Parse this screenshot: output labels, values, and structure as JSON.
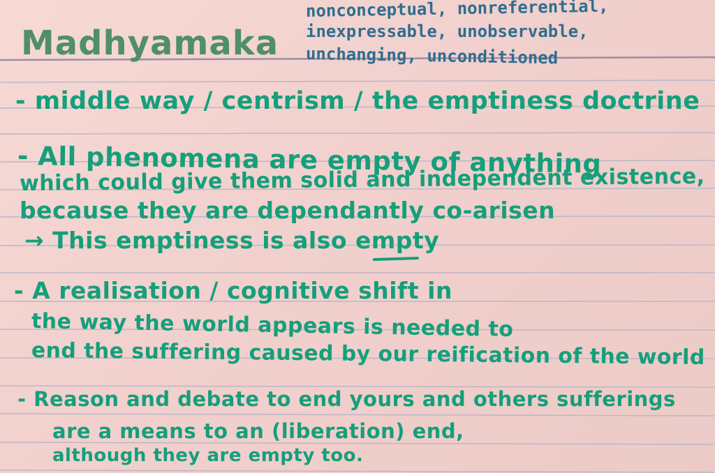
{
  "card": {
    "title": "Madhyamaka",
    "tags": [
      "nonconceptual, nonreferential,",
      "inexpressable, unobservable,",
      "unchanging, unconditioned"
    ],
    "bullets": [
      {
        "lines": [
          "- middle way / centrism / the emptiness doctrine"
        ]
      },
      {
        "lines": [
          "- All phenomena are empty of anything",
          "which could give them solid and independent existence,",
          "because they are dependantly co-arisen",
          "→ This emptiness is also empty"
        ]
      },
      {
        "lines": [
          "- A realisation / cognitive shift in",
          "the way the world appears is needed to",
          "end the suffering caused by our reification of the world"
        ]
      },
      {
        "lines": [
          "- Reason and debate to end yours and others sufferings",
          "are a means to an (liberation) end,",
          "although they are empty too."
        ]
      }
    ]
  },
  "colors": {
    "card_paper": "#f3d3cf",
    "rule_line": "#b9b7c9",
    "ink_green": "#159f7b",
    "ink_title": "#4f8f69",
    "ink_blue": "#2f6e8f"
  }
}
